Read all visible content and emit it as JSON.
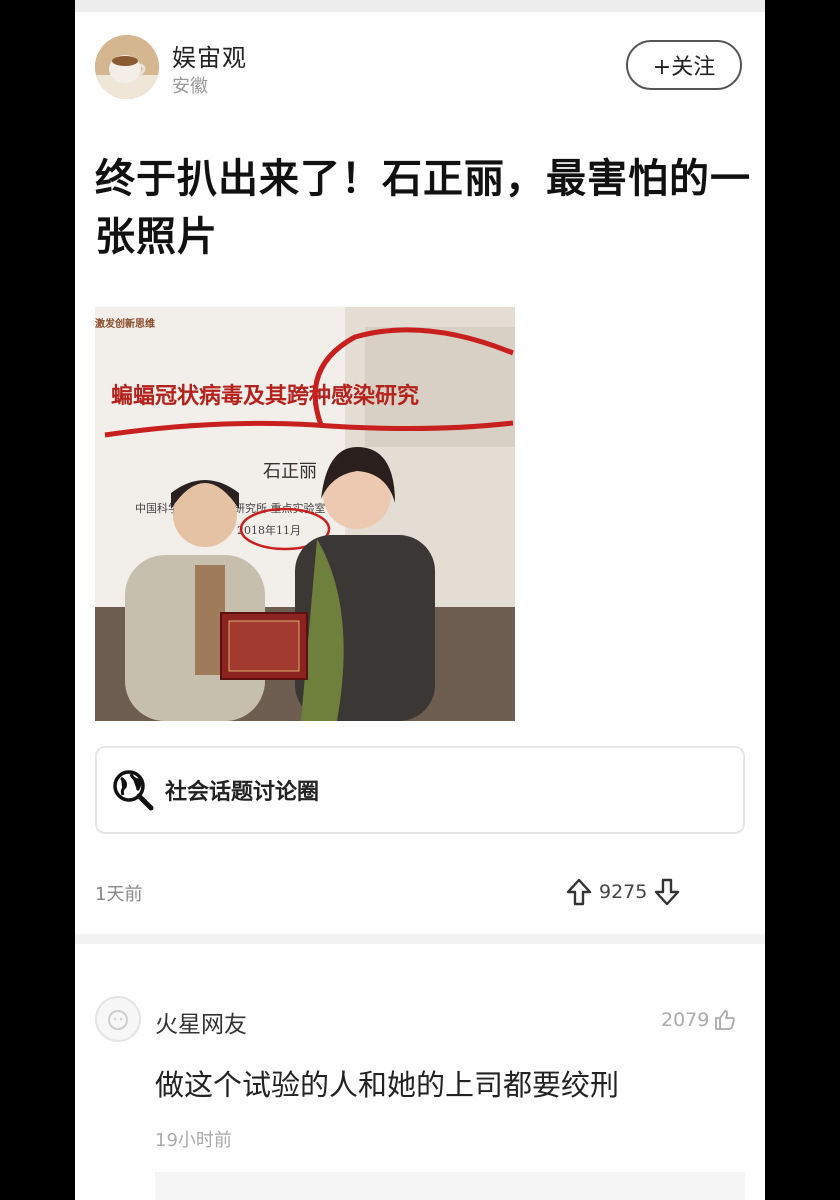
{
  "author": {
    "name": "娱宙观",
    "location": "安徽",
    "follow_label": "+关注"
  },
  "post": {
    "title": "终于扒出来了！石正丽，最害怕的一张照片",
    "photo_text": {
      "banner": "蝙蝠冠状病毒及其跨种感染研究",
      "corner": "激发创新思维",
      "speaker": "石正丽",
      "affiliation": "中国科学院武汉病毒研究所 重点实验室",
      "date": "2018年11月"
    },
    "topic_label": "社会话题讨论圈",
    "time": "1天前",
    "votes": "9275"
  },
  "comment": {
    "user": "火星网友",
    "likes": "2079",
    "text": "做这个试验的人和她的上司都要绞刑",
    "time": "19小时前"
  },
  "colors": {
    "annotation_red": "#c8201f",
    "banner_text": "#b5221d",
    "background": "#ffffff",
    "muted": "#999999"
  },
  "icons": {
    "topic": "globe-search-icon",
    "upvote": "arrow-up-icon",
    "downvote": "arrow-down-icon",
    "like": "thumbs-up-icon"
  }
}
